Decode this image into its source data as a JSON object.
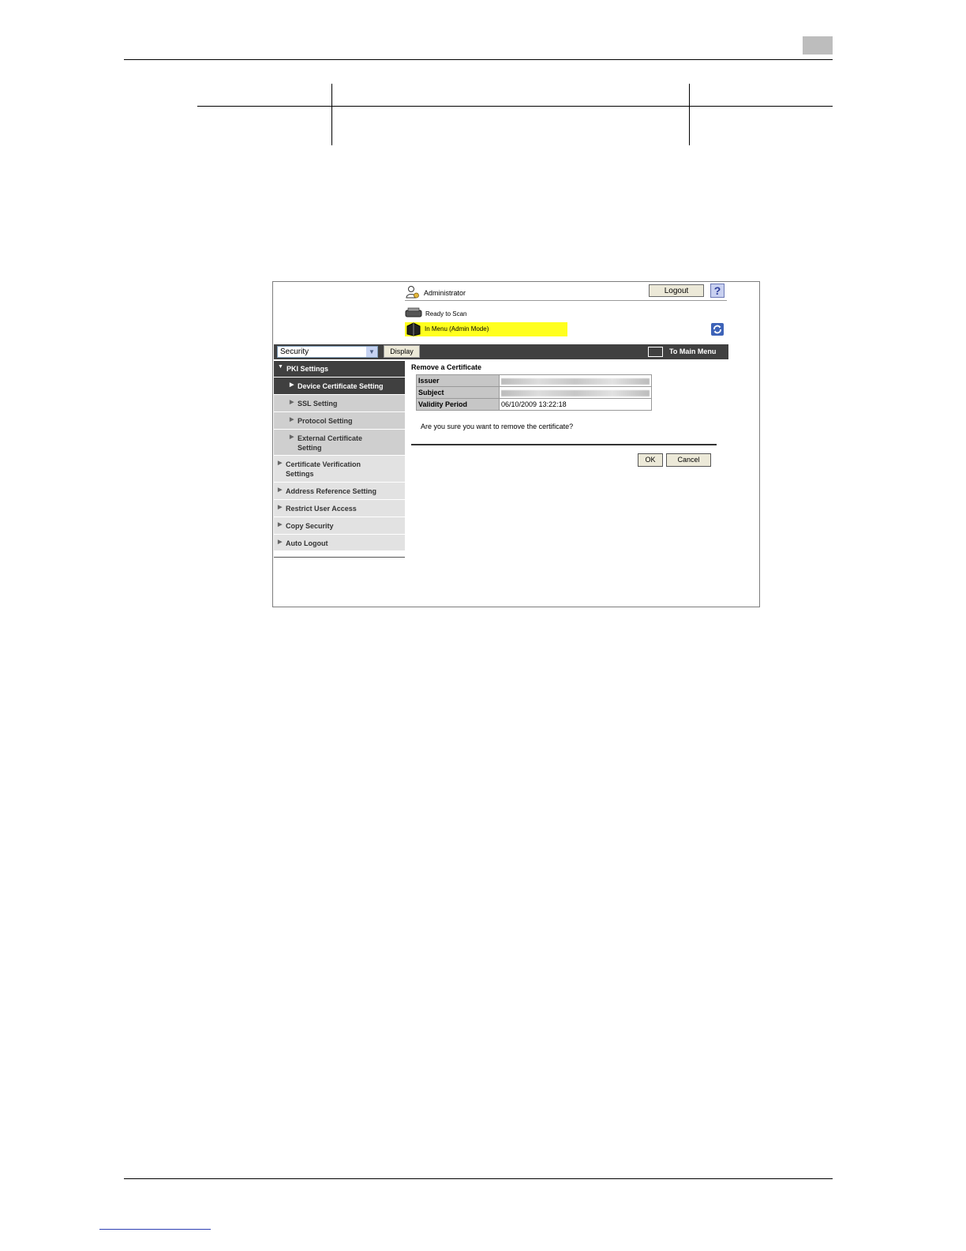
{
  "header": {
    "user": "Administrator",
    "logout_label": "Logout",
    "help_label": "?",
    "status_ready": "Ready to Scan",
    "status_mode": "In Menu (Admin Mode)"
  },
  "toolbar": {
    "category_selected": "Security",
    "display_label": "Display",
    "main_menu_label": "To Main Menu"
  },
  "sidebar": {
    "items": [
      {
        "label": "PKI Settings"
      },
      {
        "label": "Device Certificate Setting"
      },
      {
        "label": "SSL Setting"
      },
      {
        "label": "Protocol Setting"
      },
      {
        "label": "External Certificate Setting"
      },
      {
        "label": "Certificate Verification Settings"
      },
      {
        "label": "Address Reference Setting"
      },
      {
        "label": "Restrict User Access"
      },
      {
        "label": "Copy Security"
      },
      {
        "label": "Auto Logout"
      }
    ]
  },
  "main": {
    "title": "Remove a Certificate",
    "rows": [
      {
        "label": "Issuer",
        "value": ""
      },
      {
        "label": "Subject",
        "value": ""
      },
      {
        "label": "Validity Period",
        "value": "06/10/2009 13:22:18"
      }
    ],
    "question": "Are you sure you want to remove the certificate?",
    "ok_label": "OK",
    "cancel_label": "Cancel"
  },
  "colors": {
    "sidebar_active": "#404040",
    "status_highlight": "#ffff1e",
    "button_face": "#ece9d8"
  }
}
